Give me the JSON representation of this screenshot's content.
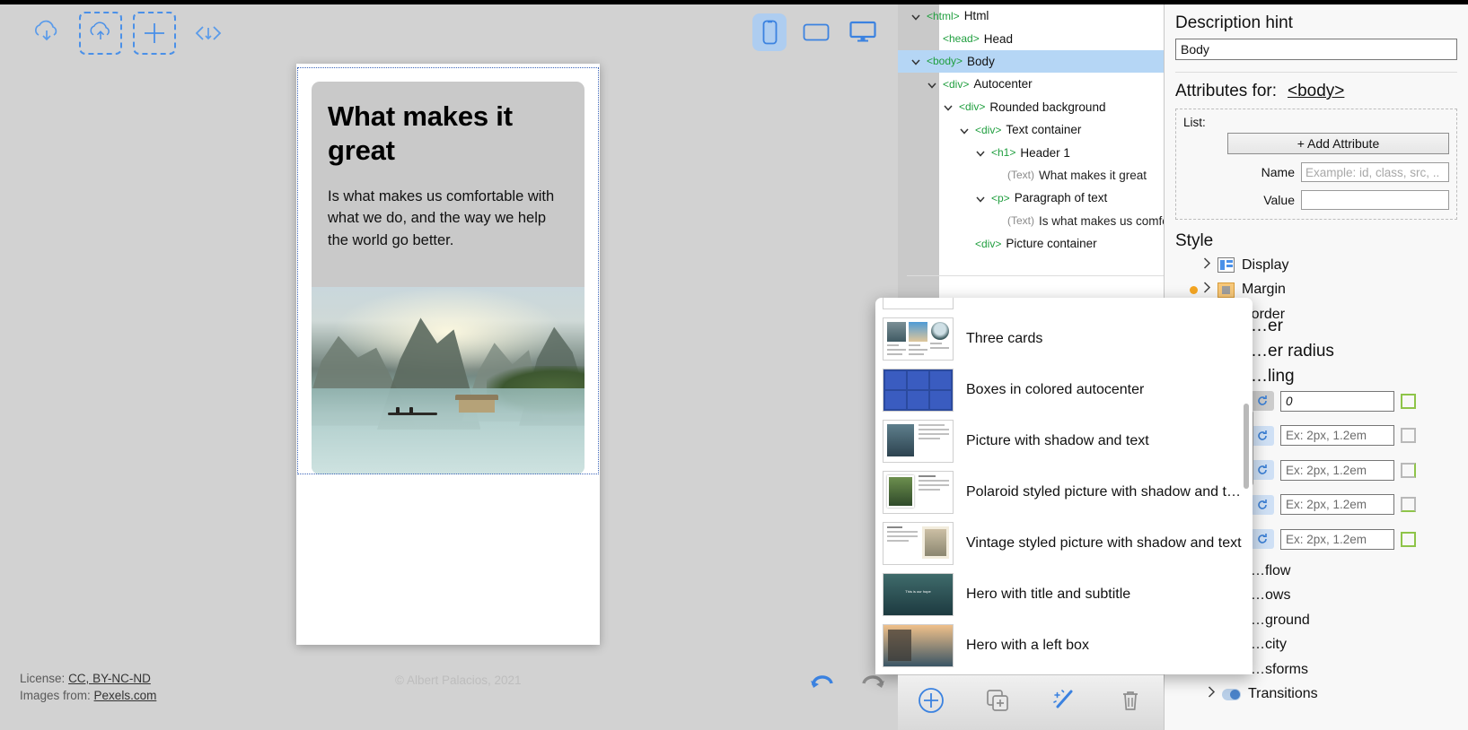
{
  "toolbar": {
    "icons": [
      {
        "name": "cloud-download-icon",
        "label": "Download"
      },
      {
        "name": "cloud-upload-icon",
        "label": "Upload"
      },
      {
        "name": "plus-icon",
        "label": "New"
      },
      {
        "name": "code-icon",
        "label": "Source code"
      }
    ],
    "devices": [
      {
        "name": "phone-icon",
        "label": "Phone",
        "active": true
      },
      {
        "name": "tablet-icon",
        "label": "Tablet",
        "active": false
      },
      {
        "name": "desktop-icon",
        "label": "Desktop",
        "active": false
      }
    ]
  },
  "canvas": {
    "card": {
      "heading": "What makes it great",
      "paragraph": "Is what makes us comfortable with what we do, and the way we help the world go better.",
      "image_alt": "Misty karst mountains over a lake with a small boat"
    },
    "credits": {
      "license_label": "License:",
      "license_value": "CC, BY-NC-ND",
      "images_label": "Images from:",
      "images_value": "Pexels.com"
    },
    "copyright": "© Albert Palacios, 2021",
    "undo_label": "Undo",
    "redo_label": "Redo"
  },
  "tree": {
    "rows": [
      {
        "tag": "<html>",
        "label": "Html",
        "indent": 0,
        "caret": true,
        "selected": false,
        "text_node": false
      },
      {
        "tag": "<head>",
        "label": "Head",
        "indent": 1,
        "caret": false,
        "selected": false,
        "text_node": false
      },
      {
        "tag": "<body>",
        "label": "Body",
        "indent": 0,
        "caret": true,
        "selected": true,
        "text_node": false
      },
      {
        "tag": "<div>",
        "label": "Autocenter",
        "indent": 1,
        "caret": true,
        "selected": false,
        "text_node": false
      },
      {
        "tag": "<div>",
        "label": "Rounded background",
        "indent": 2,
        "caret": true,
        "selected": false,
        "text_node": false
      },
      {
        "tag": "<div>",
        "label": "Text container",
        "indent": 3,
        "caret": true,
        "selected": false,
        "text_node": false
      },
      {
        "tag": "<h1>",
        "label": "Header 1",
        "indent": 4,
        "caret": true,
        "selected": false,
        "text_node": false
      },
      {
        "tag": "(Text)",
        "label": "What makes it great",
        "indent": 5,
        "caret": false,
        "selected": false,
        "text_node": true
      },
      {
        "tag": "<p>",
        "label": "Paragraph of text",
        "indent": 4,
        "caret": true,
        "selected": false,
        "text_node": false
      },
      {
        "tag": "(Text)",
        "label": "Is what makes us comfortab…",
        "indent": 5,
        "caret": false,
        "selected": false,
        "text_node": true
      },
      {
        "tag": "<div>",
        "label": "Picture container",
        "indent": 3,
        "caret": false,
        "selected": false,
        "text_node": false
      }
    ]
  },
  "props": {
    "description_hint_label": "Description hint",
    "description_hint_value": "Body",
    "attributes_label": "Attributes for:",
    "attributes_target": "<body>",
    "list_label": "List:",
    "add_attribute_label": "+ Add Attribute",
    "name_label": "Name",
    "name_placeholder": "Example: id, class, src, ..",
    "value_label": "Value",
    "value_placeholder": "",
    "style_label": "Style",
    "style_rows": [
      {
        "label": "Display",
        "icon": "display-icon",
        "modified": false
      },
      {
        "label": "Margin",
        "icon": "margin-icon",
        "modified": true
      },
      {
        "label": "Border",
        "icon": "border-icon",
        "modified": false
      }
    ],
    "occluded_rows": [
      {
        "label": "Border",
        "visible_text": "…er"
      },
      {
        "label": "Border radius",
        "visible_text": "…er radius"
      },
      {
        "label": "Padding",
        "visible_text": "…ling"
      }
    ],
    "padding_title": "Padding",
    "padding_inputs": [
      {
        "value": "0",
        "placeholder": "0",
        "reset": "reset-icon",
        "edge": "all",
        "reset_style": "gray"
      },
      {
        "value": "",
        "placeholder": "Ex: 2px, 1.2em",
        "reset": "reset-icon",
        "edge": "gray",
        "reset_style": "blue"
      },
      {
        "value": "",
        "placeholder": "Ex: 2px, 1.2em",
        "reset": "reset-icon",
        "edge": "right",
        "reset_style": "blue"
      },
      {
        "value": "",
        "placeholder": "Ex: 2px, 1.2em",
        "reset": "reset-icon",
        "edge": "bottom",
        "reset_style": "blue"
      },
      {
        "value": "",
        "placeholder": "Ex: 2px, 1.2em",
        "reset": "reset-icon",
        "edge": "all",
        "reset_style": "blue"
      }
    ],
    "lower_groups": [
      {
        "label": "Overflow",
        "visible_text": "…flow"
      },
      {
        "label": "Shadows",
        "visible_text": "…ows"
      },
      {
        "label": "Background",
        "visible_text": "…ground"
      },
      {
        "label": "Opacity",
        "visible_text": "…city"
      },
      {
        "label": "Transforms",
        "visible_text": "…sforms"
      },
      {
        "label": "Transitions",
        "visible_text": "Transitions"
      }
    ]
  },
  "popup": {
    "items": [
      {
        "label": "",
        "thumb": "lines",
        "partial": true
      },
      {
        "label": "Three cards",
        "thumb": "three-cards"
      },
      {
        "label": "Boxes in colored autocenter",
        "thumb": "boxes"
      },
      {
        "label": "Picture with shadow and text",
        "thumb": "pic-shadow"
      },
      {
        "label": "Polaroid styled picture with shadow and te…",
        "thumb": "polaroid"
      },
      {
        "label": "Vintage styled picture with shadow and text",
        "thumb": "vintage"
      },
      {
        "label": "Hero with title and subtitle",
        "thumb": "hero"
      },
      {
        "label": "Hero with a left box",
        "thumb": "hero-left"
      }
    ]
  },
  "bottombar": {
    "buttons": [
      {
        "name": "add-element-button",
        "label": "Add element"
      },
      {
        "name": "duplicate-element-button",
        "label": "Duplicate element"
      },
      {
        "name": "magic-wand-button",
        "label": "Templates"
      },
      {
        "name": "delete-element-button",
        "label": "Delete element"
      }
    ]
  },
  "colors": {
    "accent_blue": "#3b82e0",
    "selection_blue": "#b5d6f5",
    "tag_green": "#1f9e3e",
    "modified_orange": "#f5a623",
    "canvas_gray": "#d2d2d2"
  }
}
